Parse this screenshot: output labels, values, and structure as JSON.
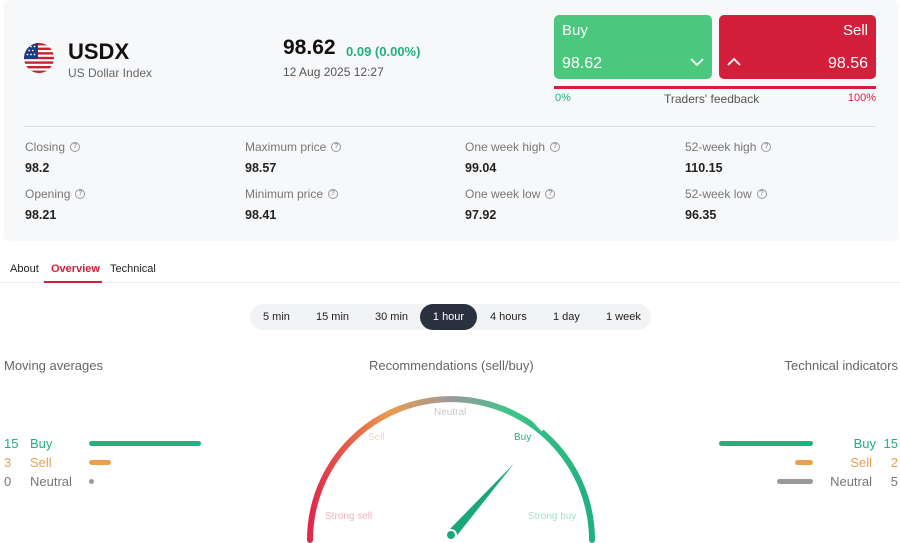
{
  "instrument": {
    "symbol": "USDX",
    "name": "US Dollar Index",
    "price": "98.62",
    "change": "0.09 (0.00%)",
    "timestamp": "12 Aug 2025 12:27"
  },
  "trade": {
    "buy_label": "Buy",
    "buy_price": "98.62",
    "sell_label": "Sell",
    "sell_price": "98.56",
    "feedback_left": "0%",
    "feedback_label": "Traders' feedback",
    "feedback_right": "100%",
    "buy_share_percent": 0
  },
  "stats": {
    "closing": {
      "label": "Closing",
      "value": "98.2"
    },
    "opening": {
      "label": "Opening",
      "value": "98.21"
    },
    "max": {
      "label": "Maximum price",
      "value": "98.57"
    },
    "min": {
      "label": "Minimum price",
      "value": "98.41"
    },
    "week_high": {
      "label": "One week high",
      "value": "99.04"
    },
    "week_low": {
      "label": "One week low",
      "value": "97.92"
    },
    "year_high": {
      "label": "52-week high",
      "value": "110.15"
    },
    "year_low": {
      "label": "52-week low",
      "value": "96.35"
    }
  },
  "tabs": [
    "About",
    "Overview",
    "Technical"
  ],
  "active_tab": "Overview",
  "timeframes": [
    "5 min",
    "15 min",
    "30 min",
    "1 hour",
    "4 hours",
    "1 day",
    "1 week"
  ],
  "active_timeframe": "1 hour",
  "moving_averages": {
    "title": "Moving averages",
    "buy": {
      "count": "15",
      "label": "Buy",
      "value": 15
    },
    "sell": {
      "count": "3",
      "label": "Sell",
      "value": 3
    },
    "neutral": {
      "count": "0",
      "label": "Neutral",
      "value": 0
    }
  },
  "recommendations": {
    "title": "Recommendations (sell/buy)",
    "labels": {
      "strong_sell": "Strong sell",
      "sell": "Sell",
      "neutral": "Neutral",
      "buy": "Buy",
      "strong_buy": "Strong buy"
    },
    "active": "Buy",
    "needle_fraction": 0.73
  },
  "technical_indicators": {
    "title": "Technical indicators",
    "buy": {
      "count": "15",
      "label": "Buy",
      "value": 15
    },
    "sell": {
      "count": "2",
      "label": "Sell",
      "value": 2
    },
    "neutral": {
      "count": "5",
      "label": "Neutral",
      "value": 5
    }
  },
  "colors": {
    "buy": "#22b07d",
    "sell": "#d41f3c",
    "ma_sell": "#e8a04f",
    "neutral": "#999999",
    "buy_button": "#4bc87e"
  },
  "icons": {
    "flag": "us-flag-icon",
    "help": "question-circle-icon",
    "buy_chevron": "chevron-down-icon",
    "sell_chevron": "chevron-up-icon"
  }
}
